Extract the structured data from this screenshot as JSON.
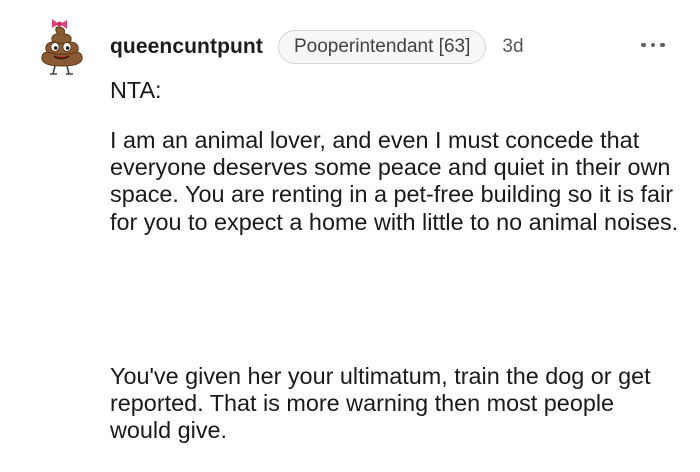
{
  "comment": {
    "username": "queencuntpunt",
    "flair": "Pooperintendant [63]",
    "timestamp": "3d",
    "avatar": "poop-emoji-avatar-icon",
    "more_icon": "more-options-icon",
    "paragraphs": [
      "NTA:",
      "I am an animal lover, and even I must concede that everyone deserves some peace and quiet in their own space. You are renting in a pet-free building so it is fair for you to expect a home with little to no animal noises.",
      "You've given her your ultimatum, train the dog or get reported. That is more warning then most people would give."
    ]
  },
  "colors": {
    "text": "#1a1a1b",
    "flair_background": "#f6f7f8",
    "flair_border": "#d5d5d5",
    "meta_text": "#575859",
    "avatar_brown": "#8a5a33"
  }
}
